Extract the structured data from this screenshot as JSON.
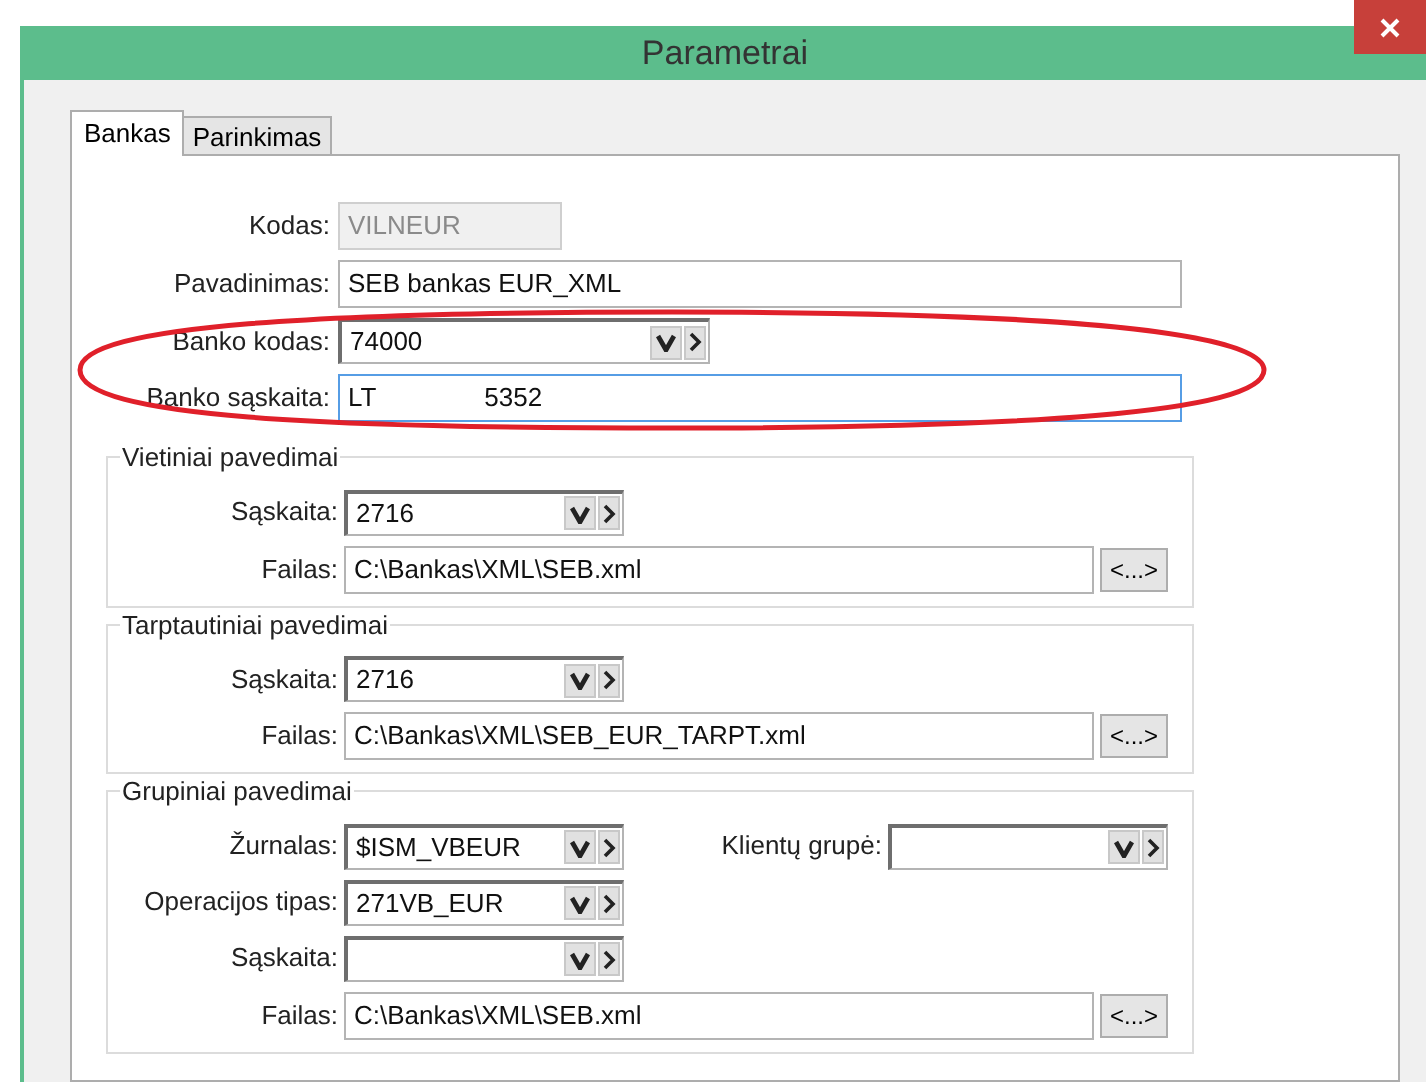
{
  "window": {
    "title": "Parametrai"
  },
  "tabs": [
    {
      "label": "Bankas",
      "selected": true
    },
    {
      "label": "Parinkimas",
      "selected": false
    }
  ],
  "fields": [
    {
      "kind": "text",
      "label": "Kodas:",
      "value": "VILNEUR",
      "disabled": true,
      "focused": false
    },
    {
      "kind": "text",
      "label": "Pavadinimas:",
      "value": "SEB bankas EUR_XML",
      "disabled": false,
      "focused": false
    },
    {
      "kind": "combo",
      "label": "Banko kodas:",
      "value": "74000"
    },
    {
      "kind": "text",
      "label": "Banko sąskaita:",
      "value": "LT               5352",
      "disabled": false,
      "focused": true
    }
  ],
  "groups": [
    {
      "title": "Vietiniai pavedimai",
      "rows": [
        [
          {
            "kind": "combo",
            "label": "Sąskaita:",
            "value": "2716"
          }
        ],
        [
          {
            "kind": "file",
            "label": "Failas:",
            "value": "C:\\Bankas\\XML\\SEB.xml",
            "button": "<...>"
          }
        ]
      ]
    },
    {
      "title": "Tarptautiniai pavedimai",
      "rows": [
        [
          {
            "kind": "combo",
            "label": "Sąskaita:",
            "value": "2716"
          }
        ],
        [
          {
            "kind": "file",
            "label": "Failas:",
            "value": "C:\\Bankas\\XML\\SEB_EUR_TARPT.xml",
            "button": "<...>"
          }
        ]
      ]
    },
    {
      "title": "Grupiniai pavedimai",
      "rows": [
        [
          {
            "kind": "combo",
            "label": "Žurnalas:",
            "value": "$ISM_VBEUR"
          },
          {
            "kind": "combo",
            "label": "Klientų grupė:"
          }
        ],
        [
          {
            "kind": "combo",
            "label": "Operacijos tipas:",
            "value": "271VB_EUR"
          }
        ],
        [
          {
            "kind": "combo",
            "label": "Sąskaita:"
          }
        ],
        [
          {
            "kind": "file",
            "label": "Failas:",
            "value": "C:\\Bankas\\XML\\SEB.xml",
            "button": "<...>"
          }
        ]
      ]
    }
  ]
}
